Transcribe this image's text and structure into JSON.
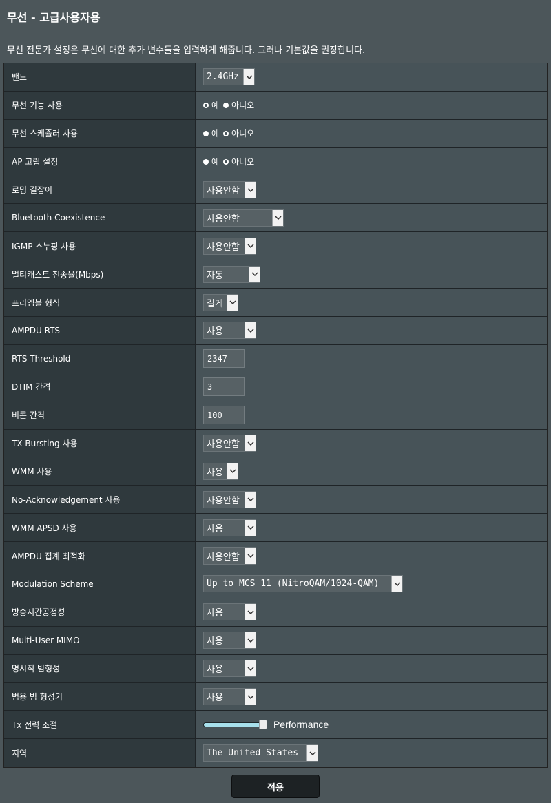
{
  "header": {
    "title": "무선 - 고급사용자용",
    "description": "무선 전문가 설정은 무선에 대한 추가 변수들을 입력하게 해줍니다. 그러나 기본값을 권장합니다."
  },
  "settings": {
    "band": {
      "label": "밴드",
      "value": "2.4GHz"
    },
    "enable_radio": {
      "label": "무선 기능 사용",
      "options": [
        "예",
        "아니오"
      ],
      "selected": "예"
    },
    "wireless_scheduler": {
      "label": "무선 스케쥴러 사용",
      "options": [
        "예",
        "아니오"
      ],
      "selected": "아니오"
    },
    "ap_isolation": {
      "label": "AP 고립 설정",
      "options": [
        "예",
        "아니오"
      ],
      "selected": "아니오"
    },
    "roaming_assistant": {
      "label": "로밍 길잡이",
      "value": "사용안함"
    },
    "bluetooth_coexistence": {
      "label": "Bluetooth Coexistence",
      "value": "사용안함"
    },
    "igmp_snooping": {
      "label": "IGMP 스누핑 사용",
      "value": "사용안함"
    },
    "multicast_rate": {
      "label": "멀티캐스트 전송율(Mbps)",
      "value": "자동"
    },
    "preamble_type": {
      "label": "프리엠블 형식",
      "value": "길게"
    },
    "ampdu_rts": {
      "label": "AMPDU RTS",
      "value": "사용"
    },
    "rts_threshold": {
      "label": "RTS Threshold",
      "value": "2347"
    },
    "dtim_interval": {
      "label": "DTIM 간격",
      "value": "3"
    },
    "beacon_interval": {
      "label": "비콘 간격",
      "value": "100"
    },
    "tx_bursting": {
      "label": "TX Bursting 사용",
      "value": "사용안함"
    },
    "wmm": {
      "label": "WMM 사용",
      "value": "사용"
    },
    "no_ack": {
      "label": "No-Acknowledgement 사용",
      "value": "사용안함"
    },
    "wmm_apsd": {
      "label": "WMM APSD 사용",
      "value": "사용"
    },
    "ampdu_aggregation": {
      "label": "AMPDU 집계 최적화",
      "value": "사용안함"
    },
    "modulation_scheme": {
      "label": "Modulation Scheme",
      "value": "Up to MCS 11 (NitroQAM/1024-QAM)"
    },
    "airtime_fairness": {
      "label": "방송시간공정성",
      "value": "사용"
    },
    "mu_mimo": {
      "label": "Multi-User MIMO",
      "value": "사용"
    },
    "explicit_beamforming": {
      "label": "명시적 빔형성",
      "value": "사용"
    },
    "universal_beamforming": {
      "label": "범용 빔 형성기",
      "value": "사용"
    },
    "tx_power": {
      "label": "Tx 전력 조절",
      "level_fraction": 1.0,
      "value_label": "Performance"
    },
    "region": {
      "label": "지역",
      "value": "The United States"
    }
  },
  "actions": {
    "apply_label": "적용"
  },
  "colors": {
    "background": "#4c565a",
    "label_cell": "#2f393d",
    "value_cell": "#475358",
    "slider_fill": "#a7e0ec",
    "apply_button": "#1d2224"
  }
}
